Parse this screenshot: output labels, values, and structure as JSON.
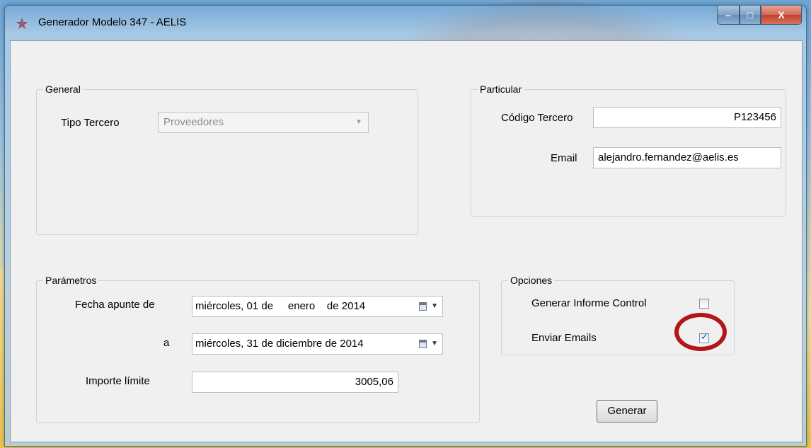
{
  "window": {
    "title": "Generador Modelo 347 - AELIS",
    "min_glyph": "–",
    "max_glyph": "□",
    "close_glyph": "X"
  },
  "general": {
    "group_label": "General",
    "tipo_tercero_label": "Tipo Tercero",
    "tipo_tercero_value": "Proveedores",
    "dropdown_glyph": "▼"
  },
  "particular": {
    "group_label": "Particular",
    "codigo_label": "Código Tercero",
    "codigo_value": "P123456",
    "email_label": "Email",
    "email_value": "alejandro.fernandez@aelis.es"
  },
  "parametros": {
    "group_label": "Parámetros",
    "fecha_desde_label": "Fecha apunte de",
    "fecha_desde_value": "miércoles, 01 de     enero    de 2014",
    "fecha_hasta_label": "a",
    "fecha_hasta_value": "miércoles, 31 de diciembre de 2014",
    "importe_label": "Importe límite",
    "importe_value": "3005,06",
    "dropdown_glyph": "▼"
  },
  "opciones": {
    "group_label": "Opciones",
    "informe_label": "Generar Informe Control",
    "informe_checked": false,
    "emails_label": "Enviar Emails",
    "emails_checked": true,
    "check_glyph": "✓"
  },
  "actions": {
    "generar_label": "Generar"
  },
  "colors": {
    "highlight_ring": "#b3161a",
    "check": "#2b4fb4"
  }
}
